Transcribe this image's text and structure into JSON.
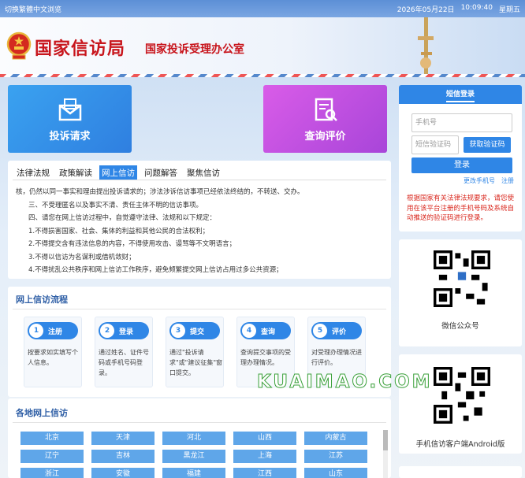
{
  "topbar": {
    "lang_switch": "切换繁體中文浏览",
    "date": "2026年05月22日",
    "time": "10:09:40",
    "weekday": "星期五"
  },
  "header": {
    "title": "国家信访局",
    "subtitle": "国家投诉受理办公室"
  },
  "actions": {
    "complaint": "投诉请求",
    "query": "查询评价"
  },
  "policy": {
    "tabs": [
      "法律法规",
      "政策解读",
      "网上信访",
      "问题解答",
      "聚焦信访"
    ],
    "active_tab": 2,
    "lines": [
      "核，仍然以同一事实和理由提出投诉请求的；涉法涉诉信访事项已经依法终结的，不转送、交办。",
      "三、不受理匿名以及事实不清、责任主体不明的信访事项。",
      "四、请您在网上信访过程中，自觉遵守法律、法规和以下规定：",
      "1.不得损害国家、社会、集体的利益和其他公民的合法权利；",
      "2.不得提交含有违法信息的内容，不得使用攻击、谩骂等不文明语言；",
      "3.不得以信访为名谋利或借机敛财；",
      "4.不得扰乱公共秩序和网上信访工作秩序，避免频繁提交网上信访占用过多公共资源；"
    ]
  },
  "flow": {
    "title": "网上信访流程",
    "steps": [
      {
        "num": "1",
        "label": "注册",
        "desc": "按要求如实填写个人信息。"
      },
      {
        "num": "2",
        "label": "登录",
        "desc": "通过姓名、证件号码或手机号码登录。"
      },
      {
        "num": "3",
        "label": "提交",
        "desc": "通过\"投诉请求\"或\"建议征集\"窗口提交。"
      },
      {
        "num": "4",
        "label": "查询",
        "desc": "查询提交事项的受理办理情况。"
      },
      {
        "num": "5",
        "label": "评价",
        "desc": "对受理办理情况进行评价。"
      }
    ]
  },
  "regions": {
    "title": "各地网上信访",
    "items": [
      "北京",
      "天津",
      "河北",
      "山西",
      "内蒙古",
      "辽宁",
      "吉林",
      "黑龙江",
      "上海",
      "江苏",
      "浙江",
      "安徽",
      "福建",
      "江西",
      "山东"
    ]
  },
  "login": {
    "tab": "短信登录",
    "phone_placeholder": "手机号",
    "code_placeholder": "短信验证码",
    "get_code": "获取验证码",
    "submit": "登录",
    "change_phone": "更改手机号",
    "register": "注册",
    "notice": "根据国家有关法律法规要求，请您使用在该平台注册的手机号码及系统自动推送的验证码进行登录。"
  },
  "qr": {
    "wechat_label": "微信公众号",
    "android_label": "手机信访客户端Android版"
  },
  "watermark": "KUAIMAO.COM",
  "colors": {
    "brand_red": "#c8161d",
    "accent_blue": "#2f86e6",
    "complaint_blue": "#3aa2f0",
    "query_purple": "#c052e2",
    "notice_red": "#d9261c"
  },
  "icons": [
    "national-emblem-icon",
    "mail-icon",
    "document-search-icon",
    "qr-code-icon"
  ]
}
